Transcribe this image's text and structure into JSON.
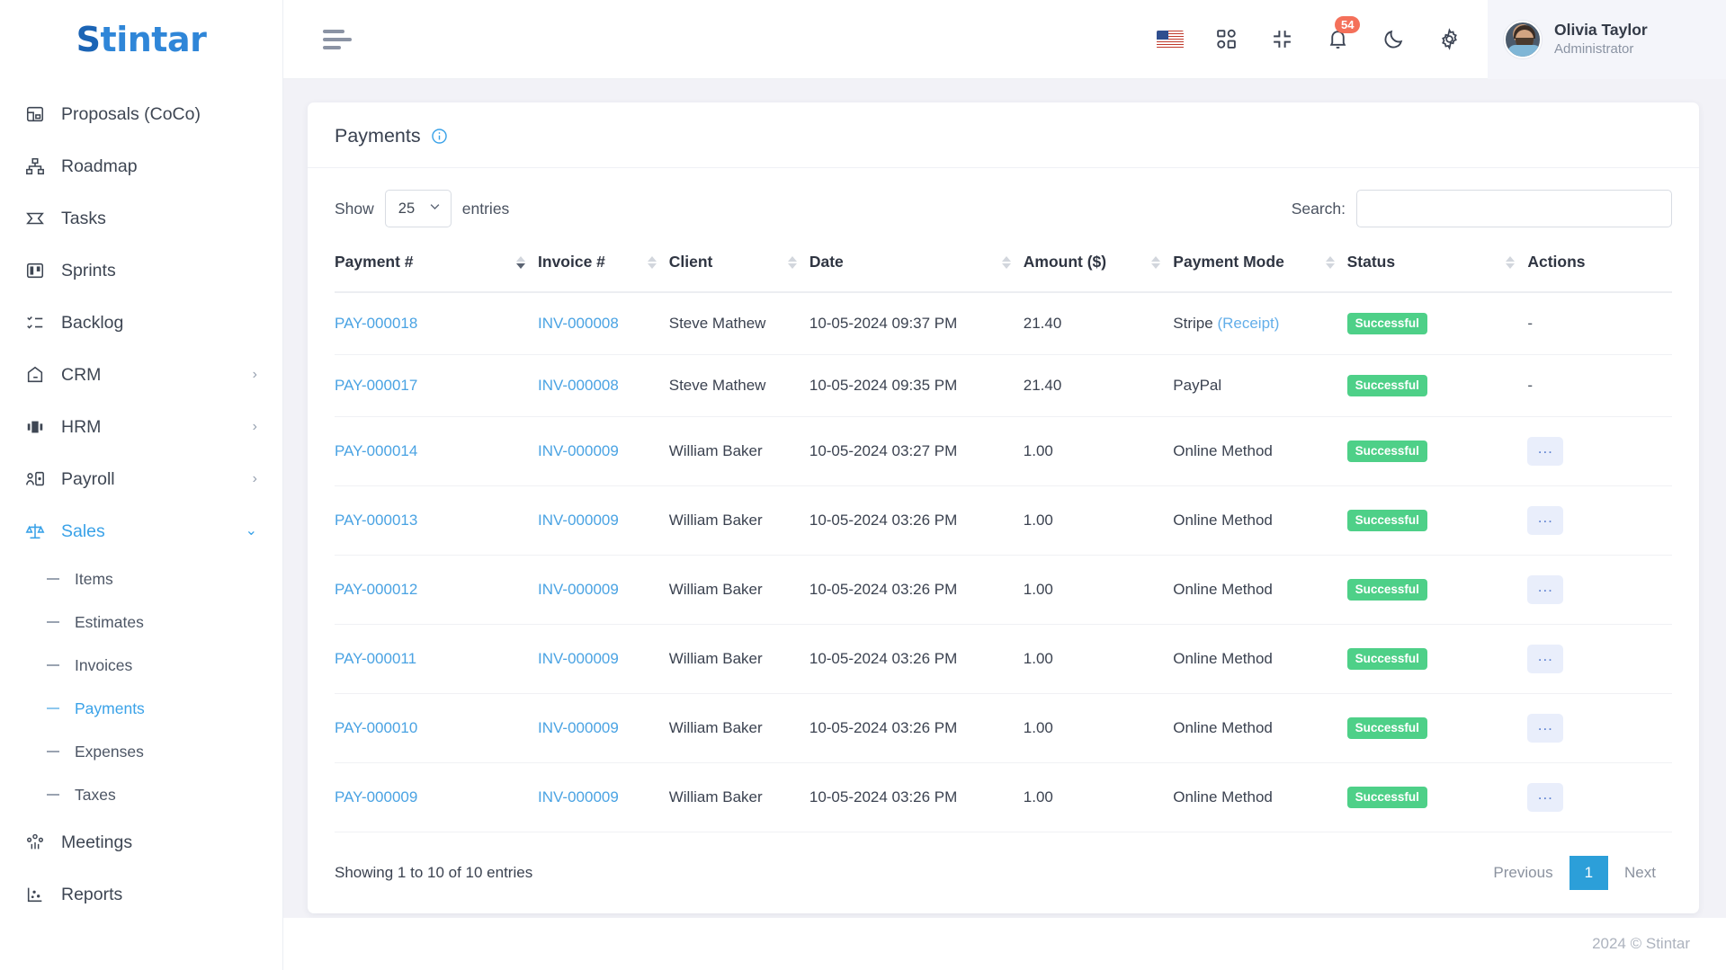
{
  "brand": {
    "prefix": "S",
    "rest": "tintar"
  },
  "sidebar": {
    "items": [
      {
        "label": "Proposals (CoCo)",
        "icon": "proposals-icon",
        "chevron": ""
      },
      {
        "label": "Roadmap",
        "icon": "roadmap-icon",
        "chevron": ""
      },
      {
        "label": "Tasks",
        "icon": "tasks-icon",
        "chevron": ""
      },
      {
        "label": "Sprints",
        "icon": "sprints-icon",
        "chevron": ""
      },
      {
        "label": "Backlog",
        "icon": "backlog-icon",
        "chevron": ""
      },
      {
        "label": "CRM",
        "icon": "crm-icon",
        "chevron": "›"
      },
      {
        "label": "HRM",
        "icon": "hrm-icon",
        "chevron": "›"
      },
      {
        "label": "Payroll",
        "icon": "payroll-icon",
        "chevron": "›"
      },
      {
        "label": "Sales",
        "icon": "sales-icon",
        "chevron": "⌄",
        "active": true
      },
      {
        "label": "Meetings",
        "icon": "meetings-icon",
        "chevron": ""
      },
      {
        "label": "Reports",
        "icon": "reports-icon",
        "chevron": ""
      }
    ],
    "sales_subitems": [
      {
        "label": "Items"
      },
      {
        "label": "Estimates"
      },
      {
        "label": "Invoices"
      },
      {
        "label": "Payments",
        "active": true
      },
      {
        "label": "Expenses"
      },
      {
        "label": "Taxes"
      }
    ]
  },
  "topbar": {
    "menu_icon": "hamburger-icon",
    "language_flag": "us-flag-icon",
    "apps_icon": "apps-grid-icon",
    "fullscreen_icon": "collapse-screen-icon",
    "notifications_icon": "bell-icon",
    "notifications_count": "54",
    "theme_icon": "moon-icon",
    "settings_icon": "gear-icon",
    "user": {
      "name": "Olivia Taylor",
      "role": "Administrator"
    }
  },
  "page": {
    "title": "Payments",
    "info_icon": "info-circle-icon"
  },
  "controls": {
    "show_label": "Show",
    "entries_label": "entries",
    "page_size": "25",
    "search_label": "Search:",
    "search_value": "",
    "search_placeholder": ""
  },
  "table": {
    "columns": [
      {
        "label": "Payment #",
        "sortable": true,
        "sort": "desc"
      },
      {
        "label": "Invoice #",
        "sortable": true,
        "sort": "none"
      },
      {
        "label": "Client",
        "sortable": true,
        "sort": "none"
      },
      {
        "label": "Date",
        "sortable": true,
        "sort": "none"
      },
      {
        "label": "Amount ($)",
        "sortable": true,
        "sort": "none"
      },
      {
        "label": "Payment Mode",
        "sortable": true,
        "sort": "none"
      },
      {
        "label": "Status",
        "sortable": true,
        "sort": "none"
      },
      {
        "label": "Actions",
        "sortable": false,
        "sort": "none"
      }
    ],
    "rows": [
      {
        "payment": "PAY-000018",
        "invoice": "INV-000008",
        "client": "Steve Mathew",
        "date": "10-05-2024 09:37 PM",
        "amount": "21.40",
        "mode": "Stripe",
        "mode_link": "(Receipt)",
        "status": "Successful",
        "action": "-"
      },
      {
        "payment": "PAY-000017",
        "invoice": "INV-000008",
        "client": "Steve Mathew",
        "date": "10-05-2024 09:35 PM",
        "amount": "21.40",
        "mode": "PayPal",
        "mode_link": "",
        "status": "Successful",
        "action": "-"
      },
      {
        "payment": "PAY-000014",
        "invoice": "INV-000009",
        "client": "William Baker",
        "date": "10-05-2024 03:27 PM",
        "amount": "1.00",
        "mode": "Online Method",
        "mode_link": "",
        "status": "Successful",
        "action": "..."
      },
      {
        "payment": "PAY-000013",
        "invoice": "INV-000009",
        "client": "William Baker",
        "date": "10-05-2024 03:26 PM",
        "amount": "1.00",
        "mode": "Online Method",
        "mode_link": "",
        "status": "Successful",
        "action": "..."
      },
      {
        "payment": "PAY-000012",
        "invoice": "INV-000009",
        "client": "William Baker",
        "date": "10-05-2024 03:26 PM",
        "amount": "1.00",
        "mode": "Online Method",
        "mode_link": "",
        "status": "Successful",
        "action": "..."
      },
      {
        "payment": "PAY-000011",
        "invoice": "INV-000009",
        "client": "William Baker",
        "date": "10-05-2024 03:26 PM",
        "amount": "1.00",
        "mode": "Online Method",
        "mode_link": "",
        "status": "Successful",
        "action": "..."
      },
      {
        "payment": "PAY-000010",
        "invoice": "INV-000009",
        "client": "William Baker",
        "date": "10-05-2024 03:26 PM",
        "amount": "1.00",
        "mode": "Online Method",
        "mode_link": "",
        "status": "Successful",
        "action": "..."
      },
      {
        "payment": "PAY-000009",
        "invoice": "INV-000009",
        "client": "William Baker",
        "date": "10-05-2024 03:26 PM",
        "amount": "1.00",
        "mode": "Online Method",
        "mode_link": "",
        "status": "Successful",
        "action": "..."
      }
    ]
  },
  "footer": {
    "showing": "Showing 1 to 10 of 10 entries",
    "previous": "Previous",
    "page_number": "1",
    "next": "Next",
    "copyright": "2024 © Stintar"
  },
  "colors": {
    "accent": "#3aa2e8",
    "success": "#4ed088",
    "badge": "#f4705a",
    "pagination_active": "#2c9fd9",
    "action_bg": "#e9eefb"
  }
}
